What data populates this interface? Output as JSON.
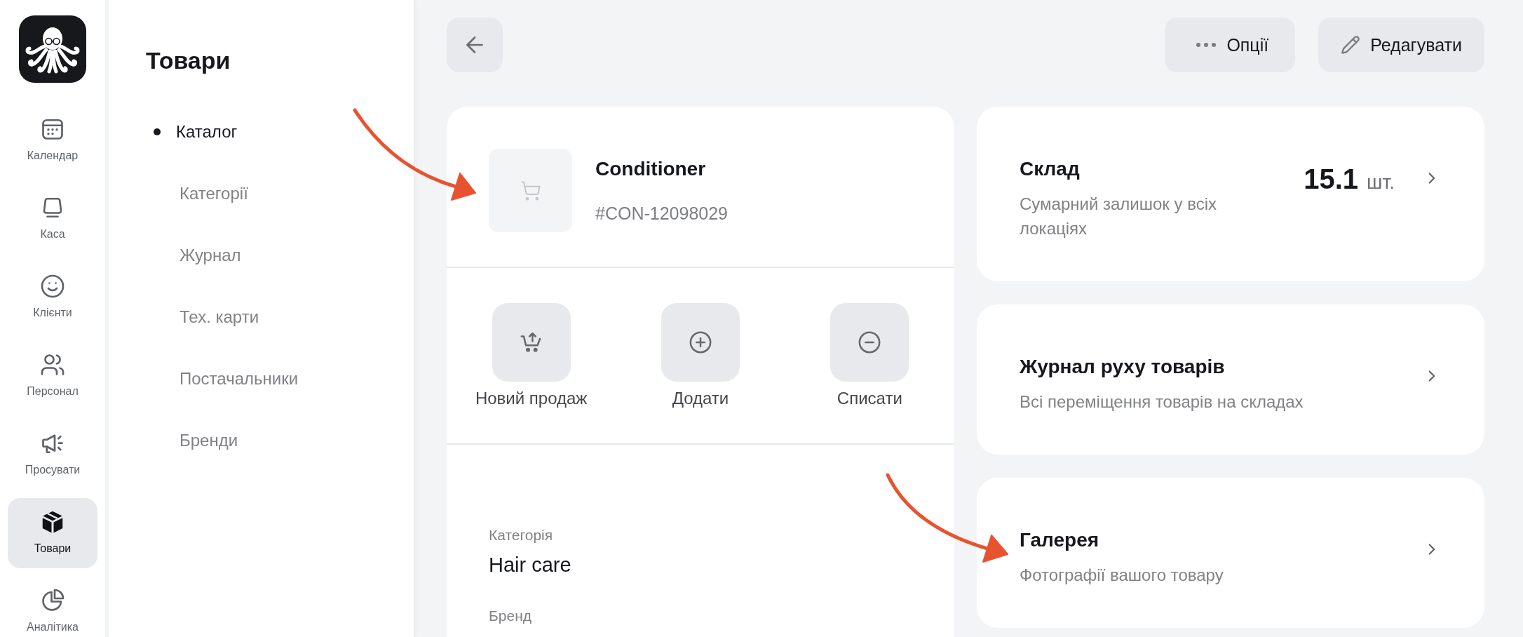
{
  "nav_rail": {
    "items": [
      {
        "label": "Календар",
        "selected": false
      },
      {
        "label": "Каса",
        "selected": false
      },
      {
        "label": "Клієнти",
        "selected": false
      },
      {
        "label": "Персонал",
        "selected": false
      },
      {
        "label": "Просувати",
        "selected": false
      },
      {
        "label": "Товари",
        "selected": true
      },
      {
        "label": "Аналітика",
        "selected": false
      }
    ]
  },
  "sidebar": {
    "title": "Товари",
    "items": [
      {
        "label": "Каталог",
        "selected": true
      },
      {
        "label": "Категорії",
        "selected": false
      },
      {
        "label": "Журнал",
        "selected": false
      },
      {
        "label": "Тех. карти",
        "selected": false
      },
      {
        "label": "Постачальники",
        "selected": false
      },
      {
        "label": "Бренди",
        "selected": false
      }
    ]
  },
  "toolbar": {
    "buttons": [
      {
        "kind": "options",
        "label": "Опції"
      },
      {
        "kind": "edit",
        "label": "Редагувати"
      }
    ]
  },
  "product": {
    "name": "Conditioner",
    "sku": "#CON-12098029",
    "actions": [
      {
        "kind": "sale",
        "label": "Новий продаж"
      },
      {
        "kind": "add",
        "label": "Додати"
      },
      {
        "kind": "write_off",
        "label": "Списати"
      }
    ],
    "details": [
      {
        "label": "Категорія",
        "value": "Hair care"
      },
      {
        "label": "Бренд"
      }
    ]
  },
  "cards": [
    {
      "title": "Склад",
      "subtitle": "Сумарний залишок у всіх локаціях",
      "value": "15.1",
      "unit": "шт."
    },
    {
      "title": "Журнал руху товарів",
      "subtitle": "Всі переміщення товарів на складах"
    },
    {
      "title": "Галерея",
      "subtitle": "Фотографії вашого товару"
    }
  ],
  "annotations": [
    {
      "kind": "arrow"
    },
    {
      "kind": "arrow"
    }
  ]
}
